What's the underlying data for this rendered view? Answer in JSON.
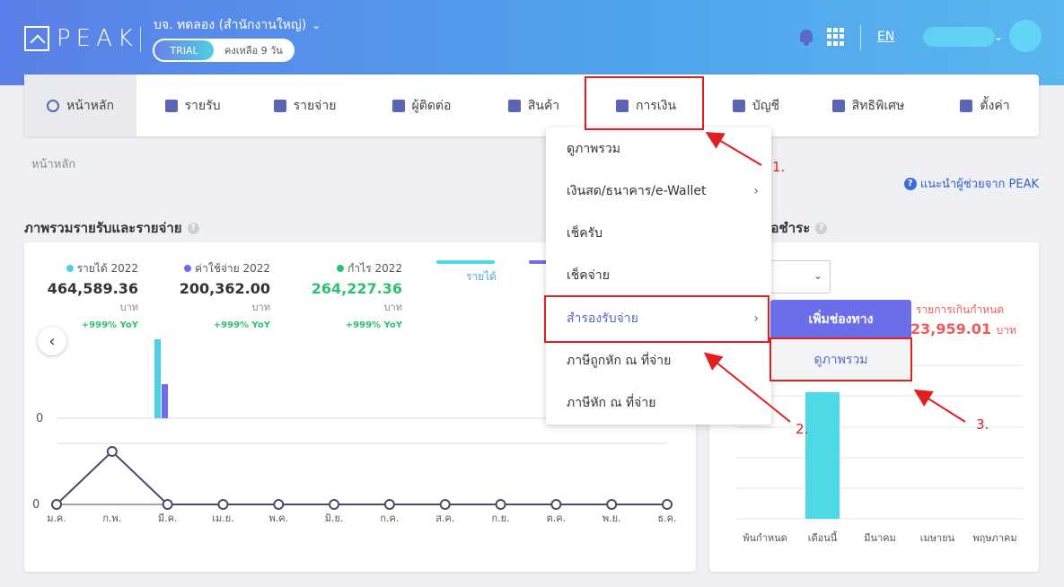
{
  "header": {
    "logo": "PEAK",
    "company": "บจ. ทดลอง (สำนักงานใหญ่)",
    "trial_tag": "TRIAL",
    "trial_days": "คงเหลือ 9 วัน",
    "language": "EN"
  },
  "nav": {
    "items": [
      {
        "label": "หน้าหลัก",
        "icon": "dashboard-icon"
      },
      {
        "label": "รายรับ",
        "icon": "income-icon"
      },
      {
        "label": "รายจ่าย",
        "icon": "expense-icon"
      },
      {
        "label": "ผู้ติดต่อ",
        "icon": "contacts-icon"
      },
      {
        "label": "สินค้า",
        "icon": "box-icon"
      },
      {
        "label": "การเงิน",
        "icon": "money-icon"
      },
      {
        "label": "บัญชี",
        "icon": "book-icon"
      },
      {
        "label": "สิทธิพิเศษ",
        "icon": "megaphone-icon"
      },
      {
        "label": "ตั้งค่า",
        "icon": "gear-icon"
      }
    ]
  },
  "breadcrumb": "หน้าหลัก",
  "help_link": "แนะนำผู้ช่วยจาก PEAK",
  "overview": {
    "title": "ภาพรวมรายรับและรายจ่าย",
    "stats": [
      {
        "label": "รายได้ 2022",
        "value": "464,589.36",
        "unit": "บาท",
        "yoy": "+999% YoY",
        "color": "#4dd0e1"
      },
      {
        "label": "ค่าใช้จ่าย 2022",
        "value": "200,362.00",
        "unit": "บาท",
        "yoy": "+999% YoY",
        "color": "#6b6ee8"
      },
      {
        "label": "กำไร 2022",
        "value": "264,227.36",
        "unit": "บาท",
        "yoy": "+999% YoY",
        "color": "#2fbf71"
      }
    ],
    "tab_income": "รายได้"
  },
  "receivable": {
    "title": "/รอชำระ",
    "overdue_label": "รายการเกินกำหนด",
    "overdue_value": "23,959.01",
    "overdue_unit": "บาท"
  },
  "dropdown": {
    "items": [
      {
        "label": "ดูภาพรวม",
        "submenu": false
      },
      {
        "label": "เงินสด/ธนาคาร/e-Wallet",
        "submenu": true
      },
      {
        "label": "เช็ครับ",
        "submenu": false
      },
      {
        "label": "เช็คจ่าย",
        "submenu": false
      },
      {
        "label": "สำรองรับจ่าย",
        "submenu": true
      },
      {
        "label": "ภาษีถูกหัก ณ ที่จ่าย",
        "submenu": false
      },
      {
        "label": "ภาษีหัก ณ ที่จ่าย",
        "submenu": false
      }
    ],
    "submenu_add": "เพิ่มช่องทาง",
    "submenu_view": "ดูภาพรวม"
  },
  "annotations": [
    "1.",
    "2.",
    "3."
  ],
  "chart_data": [
    {
      "type": "bar",
      "categories": [
        "ม.ค.",
        "ก.พ.",
        "มี.ค."
      ],
      "series": [
        {
          "name": "รายได้ 2022",
          "values": [
            0,
            464589.36,
            0
          ],
          "color": "#4dd0e1"
        },
        {
          "name": "ค่าใช้จ่าย 2022",
          "values": [
            0,
            200362.0,
            0
          ],
          "color": "#6b6ee8"
        }
      ],
      "yticks": [
        "0"
      ]
    },
    {
      "type": "line",
      "categories": [
        "ม.ค.",
        "ก.พ.",
        "มี.ค.",
        "เม.ย.",
        "พ.ค.",
        "มิ.ย.",
        "ก.ค.",
        "ส.ค.",
        "ก.ย.",
        "ต.ค.",
        "พ.ย.",
        "ธ.ค."
      ],
      "values": [
        0,
        264227.36,
        0,
        0,
        0,
        0,
        0,
        0,
        0,
        0,
        0,
        0
      ],
      "yticks": [
        "0"
      ]
    },
    {
      "type": "bar",
      "categories": [
        "พ้นกำหนด",
        "เดือนนี้",
        "มีนาคม",
        "เมษายน",
        "พฤษภาคม"
      ],
      "values": [
        0,
        1,
        0,
        0,
        0
      ],
      "color": "#4dd9e6"
    }
  ]
}
